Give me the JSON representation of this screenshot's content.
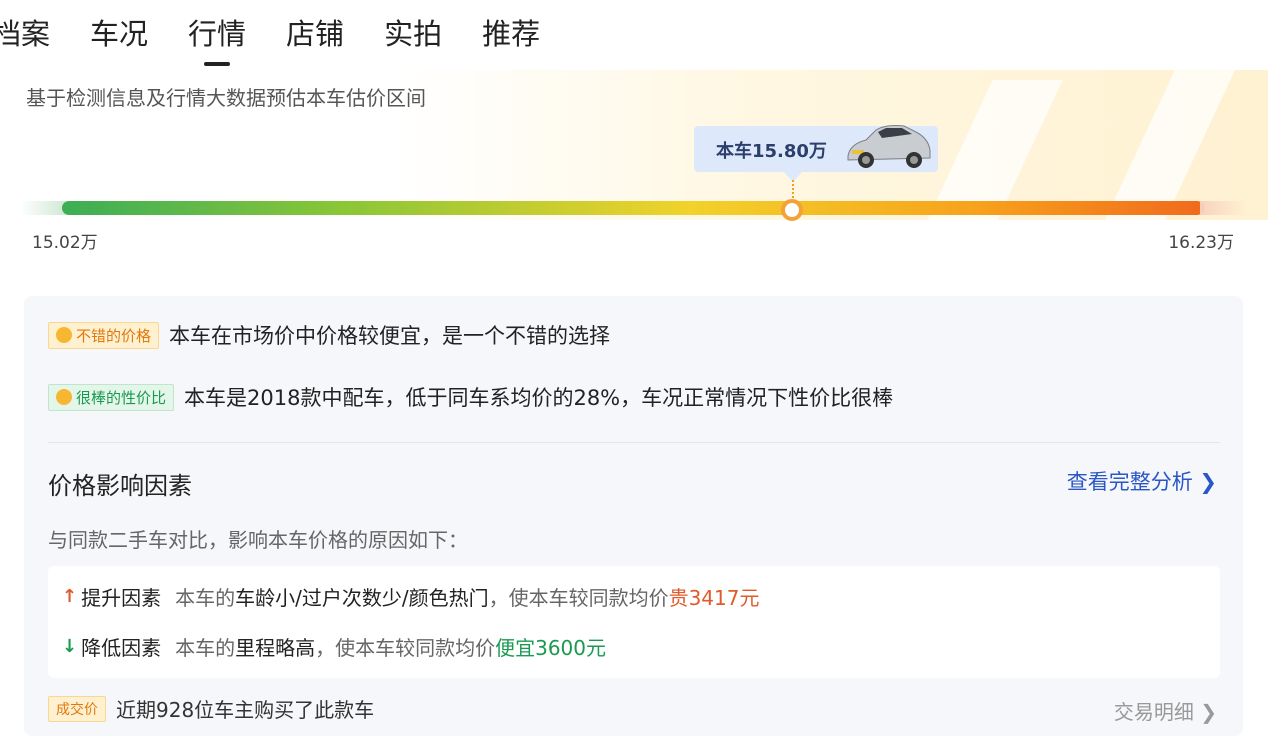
{
  "tabs": [
    {
      "label": "档案",
      "active": false
    },
    {
      "label": "车况",
      "active": false
    },
    {
      "label": "行情",
      "active": true
    },
    {
      "label": "店铺",
      "active": false
    },
    {
      "label": "实拍",
      "active": false
    },
    {
      "label": "推荐",
      "active": false
    }
  ],
  "estimate": {
    "subtitle": "基于检测信息及行情大数据预估本车估价区间",
    "this_car_label": "本车15.80万",
    "min_label": "15.02万",
    "max_label": "16.23万",
    "min_value": 15.02,
    "max_value": 16.23,
    "car_value": 15.8
  },
  "summary": {
    "tag1": {
      "label": "不错的价格",
      "color": "#e07a10"
    },
    "line1": "本车在市场价中价格较便宜，是一个不错的选择",
    "tag2": {
      "label": "很棒的性价比",
      "color": "#1a9a50"
    },
    "line2": "本车是2018款中配车，低于同车系均价的28%，车况正常情况下性价比很棒"
  },
  "factors": {
    "title": "价格影响因素",
    "link": "查看完整分析 ❯",
    "subtitle": "与同款二手车对比，影响本车价格的原因如下：",
    "up": {
      "label": "提升因素",
      "prefix": "本车的",
      "bold": "车龄小/过户次数少/颜色热门",
      "mid": "，使本车较同款均价",
      "value": "贵3417元"
    },
    "down": {
      "label": "降低因素",
      "prefix": "本车的",
      "bold": "里程略高",
      "mid": "，使本车较同款均价",
      "value": "便宜3600元"
    }
  },
  "peek": {
    "tag": "成交价",
    "text": "近期928位车主购买了此款车",
    "right": "交易明细 ❯"
  },
  "colors": {
    "up": "#e05a2a",
    "down": "#1a9a50",
    "link": "#2a56c6"
  }
}
